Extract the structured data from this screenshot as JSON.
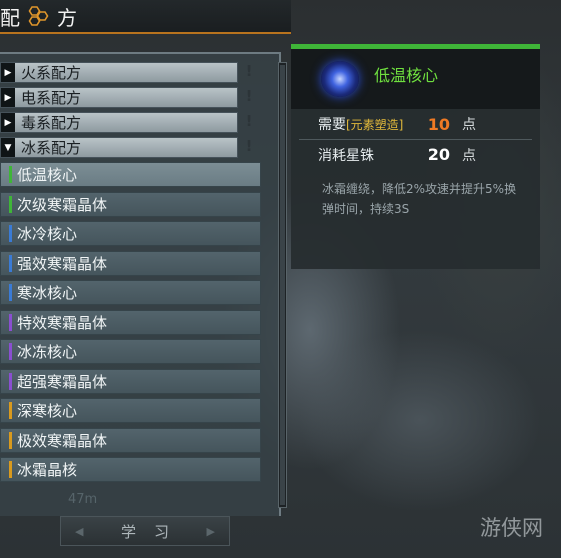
{
  "header": {
    "title_left": "配",
    "title_right": "方",
    "icon": "honeycomb-icon"
  },
  "categories": [
    {
      "label": "火系配方",
      "expanded": false
    },
    {
      "label": "电系配方",
      "expanded": false
    },
    {
      "label": "毒系配方",
      "expanded": false
    },
    {
      "label": "冰系配方",
      "expanded": true
    }
  ],
  "category_mark": "!",
  "items": [
    {
      "label": "低温核心",
      "color": "#3fb538",
      "selected": true
    },
    {
      "label": "次级寒霜晶体",
      "color": "#3fb538",
      "selected": false
    },
    {
      "label": "冰冷核心",
      "color": "#3a7bd5",
      "selected": false
    },
    {
      "label": "强效寒霜晶体",
      "color": "#3a7bd5",
      "selected": false
    },
    {
      "label": "寒冰核心",
      "color": "#3a7bd5",
      "selected": false
    },
    {
      "label": "特效寒霜晶体",
      "color": "#8a4fd0",
      "selected": false
    },
    {
      "label": "冰冻核心",
      "color": "#8a4fd0",
      "selected": false
    },
    {
      "label": "超强寒霜晶体",
      "color": "#8a4fd0",
      "selected": false
    },
    {
      "label": "深寒核心",
      "color": "#d99a1e",
      "selected": false
    },
    {
      "label": "极效寒霜晶体",
      "color": "#d99a1e",
      "selected": false
    },
    {
      "label": "冰霜晶核",
      "color": "#d99a1e",
      "selected": false
    }
  ],
  "faint_text": "47m",
  "learn": {
    "label": "学习"
  },
  "detail": {
    "name": "低温核心",
    "icon": "frost-orb-icon",
    "require": {
      "label": "需要",
      "tag": "[元素塑造]",
      "value": "10",
      "unit": "点",
      "color": "#f07a24"
    },
    "cost": {
      "label": "消耗星铢",
      "value": "20",
      "unit": "点",
      "color": "#ffffff"
    },
    "description": "冰霜缠绕，降低2%攻速并提升5%换弹时间，持续3S"
  },
  "watermark": "游侠网"
}
